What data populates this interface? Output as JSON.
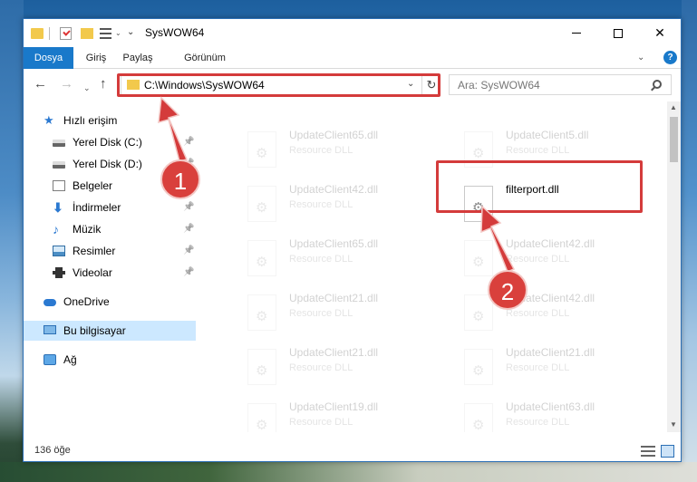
{
  "window": {
    "title": "SysWOW64",
    "controls": {
      "minimize": "—",
      "maximize": "☐",
      "close": "✕"
    }
  },
  "ribbon": {
    "tabs": [
      "Dosya",
      "Giriş",
      "Paylaş",
      "Görünüm"
    ],
    "expand": "⌄",
    "help": "?"
  },
  "address": {
    "path": "C:\\Windows\\SysWOW64",
    "search_placeholder": "Ara: SysWOW64"
  },
  "icons": {
    "back": "←",
    "forward": "→",
    "recent": "⌄",
    "up": "↑",
    "chevron": "⌄",
    "refresh": "↻",
    "pin": "📌",
    "scroll_up": "▲",
    "scroll_down": "▼"
  },
  "nav": {
    "items": [
      {
        "label": "Hızlı erişim",
        "icon": "quick-access-icon",
        "pinned": false
      },
      {
        "label": "Yerel Disk (C:)",
        "icon": "disk-icon",
        "pinned": true
      },
      {
        "label": "Yerel Disk (D:)",
        "icon": "disk-icon",
        "pinned": true
      },
      {
        "label": "Belgeler",
        "icon": "documents-icon",
        "pinned": true
      },
      {
        "label": "İndirmeler",
        "icon": "downloads-icon",
        "pinned": true
      },
      {
        "label": "Müzik",
        "icon": "music-icon",
        "pinned": true
      },
      {
        "label": "Resimler",
        "icon": "pictures-icon",
        "pinned": true
      },
      {
        "label": "Videolar",
        "icon": "videos-icon",
        "pinned": true
      },
      {
        "label": "OneDrive",
        "icon": "onedrive-icon",
        "pinned": false
      },
      {
        "label": "Bu bilgisayar",
        "icon": "this-pc-icon",
        "pinned": false,
        "selected": true
      },
      {
        "label": "Ağ",
        "icon": "network-icon",
        "pinned": false
      }
    ]
  },
  "files": [
    {
      "name": "UpdateClient65.dll",
      "desc": "Resource DLL",
      "faded": true
    },
    {
      "name": "UpdateClient5.dll",
      "desc": "Resource DLL",
      "faded": true
    },
    {
      "name": "UpdateClient42.dll",
      "desc": "Resource DLL",
      "faded": true
    },
    {
      "name": "filterport.dll",
      "desc": "",
      "faded": false
    },
    {
      "name": "UpdateClient65.dll",
      "desc": "Resource DLL",
      "faded": true
    },
    {
      "name": "UpdateClient42.dll",
      "desc": "Resource DLL",
      "faded": true
    },
    {
      "name": "UpdateClient21.dll",
      "desc": "Resource DLL",
      "faded": true
    },
    {
      "name": "UpdateClient42.dll",
      "desc": "Resource DLL",
      "faded": true
    },
    {
      "name": "UpdateClient21.dll",
      "desc": "Resource DLL",
      "faded": true
    },
    {
      "name": "UpdateClient21.dll",
      "desc": "Resource DLL",
      "faded": true
    },
    {
      "name": "UpdateClient19.dll",
      "desc": "Resource DLL",
      "faded": true
    },
    {
      "name": "UpdateClient63.dll",
      "desc": "Resource DLL",
      "faded": true
    }
  ],
  "status": {
    "count": "136 öğe"
  },
  "annotations": {
    "step1": "1",
    "step2": "2",
    "color": "#d43b3b"
  }
}
